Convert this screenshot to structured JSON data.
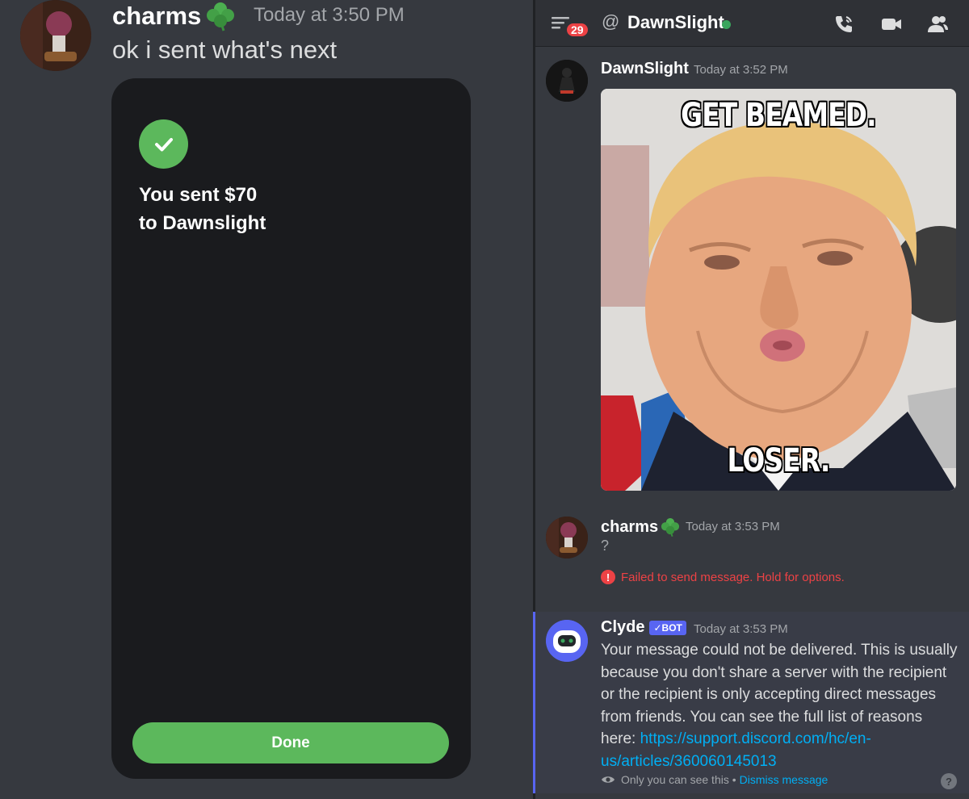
{
  "left": {
    "author": "charms",
    "timestamp": "Today at 3:50 PM",
    "message": "ok i sent what's next",
    "payment": {
      "line1": "You sent $70",
      "line2": "to Dawnslight",
      "done_label": "Done"
    }
  },
  "header": {
    "badge_count": "29",
    "at_symbol": "@",
    "dm_name": "DawnSlight",
    "status_color": "#3ba55d"
  },
  "messages": {
    "dawn": {
      "author": "DawnSlight",
      "timestamp": "Today at 3:52 PM",
      "meme_top": "GET BEAMED.",
      "meme_bottom": "LOSER."
    },
    "charms": {
      "author": "charms",
      "timestamp": "Today at 3:53 PM",
      "text": "?",
      "failed": "Failed to send message. Hold for options."
    },
    "clyde": {
      "author": "Clyde",
      "bot_tag": "✓BOT",
      "timestamp": "Today at 3:53 PM",
      "text": "Your message could not be delivered. This is usually because you don't share a server with the recipient or the recipient is only accepting direct messages from friends. You can see the full list of reasons here: ",
      "link": "https://support.discord.com/hc/en-us/articles/360060145013",
      "only_you": "Only you can see this •",
      "dismiss": "Dismiss message"
    }
  },
  "colors": {
    "accent_green": "#5cb85c",
    "error_red": "#ed4245",
    "blurple": "#5865f2",
    "link_blue": "#00aff4"
  },
  "icons": [
    "clover-icon",
    "check-icon",
    "menu-icon",
    "call-icon",
    "video-icon",
    "members-icon",
    "error-icon",
    "eye-icon",
    "help-icon"
  ]
}
